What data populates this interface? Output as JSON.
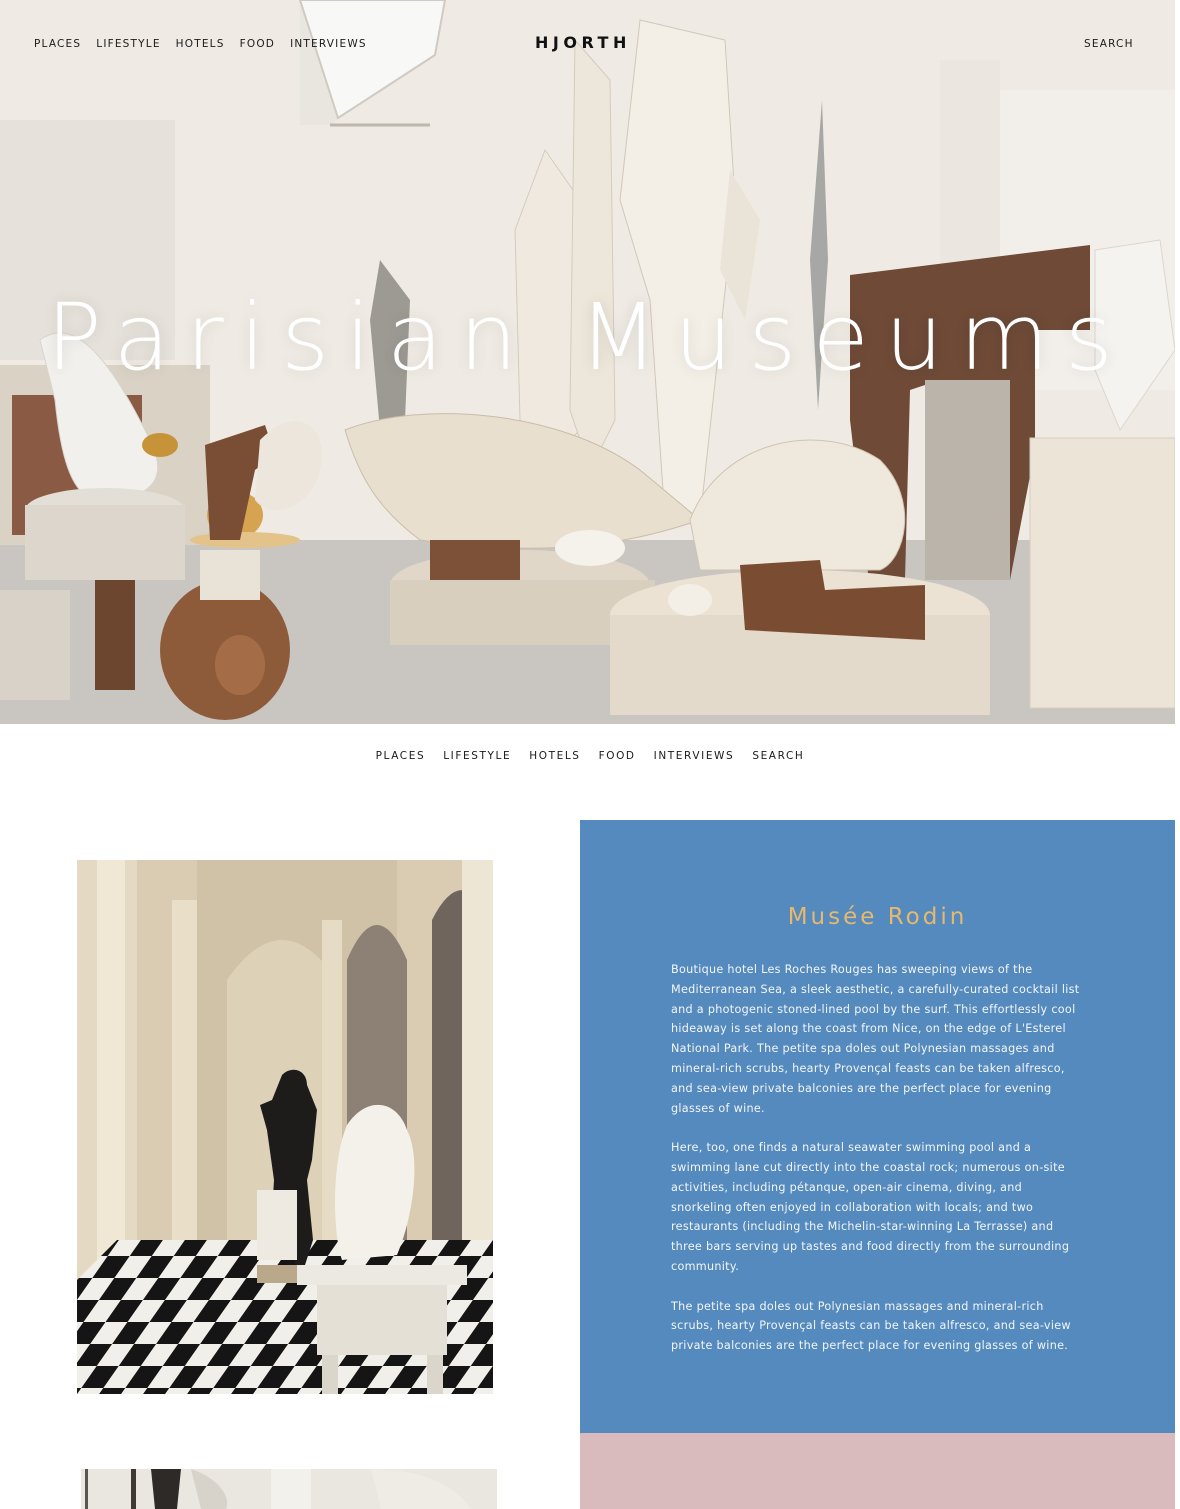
{
  "header": {
    "nav": [
      "PLACES",
      "LIFESTYLE",
      "HOTELS",
      "FOOD",
      "INTERVIEWS"
    ],
    "brand": "HJORTH",
    "search": "SEARCH"
  },
  "hero": {
    "title": "Parisian Museums"
  },
  "subnav": [
    "PLACES",
    "LIFESTYLE",
    "HOTELS",
    "FOOD",
    "INTERVIEWS",
    "SEARCH"
  ],
  "article": {
    "title": "Musée Rodin",
    "paragraphs": [
      "Boutique hotel Les Roches Rouges has sweeping views of the Mediterranean Sea, a sleek aesthetic, a carefully-curated cocktail list and a photogenic stoned-lined pool by the surf. This effortlessly cool hideaway is set along the coast from Nice, on the edge of L'Esterel National Park. The petite spa doles out Polynesian massages and mineral-rich scrubs, hearty Provençal feasts can be taken alfresco, and sea-view private balconies are the perfect place for evening glasses of wine.",
      "Here, too, one finds a natural seawater swimming pool and a swimming lane cut directly into the coastal rock; numerous on-site activities, including pétanque, open-air cinema, diving, and snorkeling often enjoyed in collaboration with locals; and two restaurants (including the Michelin-star-winning La Terrasse) and three bars serving up tastes and food directly from the surrounding community.",
      "The petite spa doles out Polynesian massages and mineral-rich scrubs, hearty Provençal feasts can be taken alfresco, and sea-view private balconies are the perfect place for evening glasses of wine."
    ]
  },
  "colors": {
    "panel_blue": "#548abd",
    "panel_pink": "#d9bbbd",
    "title_gold": "#e7b86d"
  }
}
